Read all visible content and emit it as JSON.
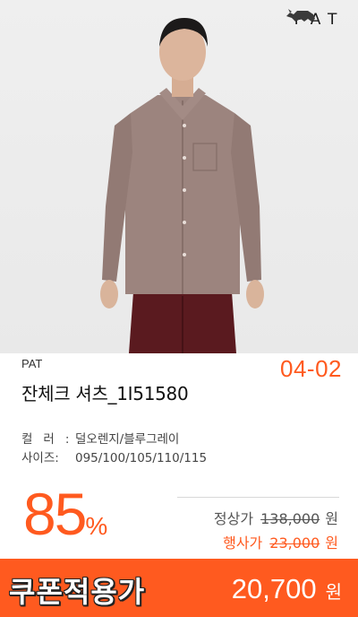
{
  "brand": {
    "logo_text": "PAT",
    "logo_icon": "rhino-icon",
    "name": "PAT"
  },
  "product": {
    "date_code": "04-02",
    "name": "잔체크 셔츠_1I51580",
    "color_label": "컬러:",
    "color_value": "덜오렌지/블루그레이",
    "size_label": "사이즈:",
    "size_value": "095/100/105/110/115"
  },
  "pricing": {
    "discount_value": "85",
    "discount_unit": "%",
    "regular_label": "정상가",
    "regular_price": "138,000",
    "event_label": "행사가",
    "event_price": "23,000",
    "currency": "원"
  },
  "coupon": {
    "label": "쿠폰적용가",
    "price": "20,700",
    "currency": "원"
  },
  "colors": {
    "accent": "#ff5a1f",
    "shirt": "#9c847e",
    "pants": "#5a1a1f",
    "background": "#ececec"
  }
}
